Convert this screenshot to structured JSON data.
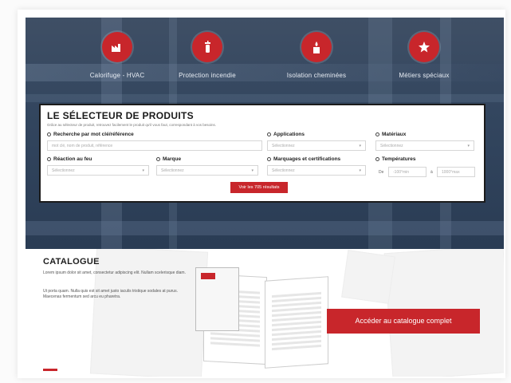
{
  "categories": [
    {
      "label": "Calorifuge - HVAC",
      "icon": "factory-icon"
    },
    {
      "label": "Protection incendie",
      "icon": "fire-extinguisher-icon"
    },
    {
      "label": "Isolation cheminées",
      "icon": "chimney-flame-icon"
    },
    {
      "label": "Métiers spéciaux",
      "icon": "star-icon"
    }
  ],
  "selector": {
    "title": "LE SÉLECTEUR DE PRODUITS",
    "subtitle": "Grâce au sélecteur de produit, retrouvez facilement le produit qu'il vous faut, correspondant à vos besoins.",
    "fields": {
      "keyword": {
        "label": "Recherche par mot clé/référence",
        "placeholder": "mot clé, nom de produit, référence"
      },
      "applications": {
        "label": "Applications",
        "placeholder": "Sélectionnez"
      },
      "materials": {
        "label": "Matériaux",
        "placeholder": "Sélectionnez"
      },
      "fire_reaction": {
        "label": "Réaction au feu",
        "placeholder": "Sélectionnez"
      },
      "brand": {
        "label": "Marque",
        "placeholder": "Sélectionnez"
      },
      "certifications": {
        "label": "Marquages et certifications",
        "placeholder": "Sélectionnez"
      },
      "temperatures": {
        "label": "Températures",
        "from_label": "De",
        "to_label": "à",
        "min_placeholder": "-100°min",
        "max_placeholder": "1000°max"
      }
    },
    "results_button": "Voir les 705 résultats"
  },
  "catalogue": {
    "title": "CATALOGUE",
    "text1": "Lorem ipsum dolor sit amet, consectetur adipiscing elit. Nullam scelerisque diam.",
    "text2": "Ut porta quam. Nulla quis est sit amet justo iaculis tristique sodales at purus. Maecenas fermentum sed arcu eu pharetra.",
    "access_button": "Accéder au catalogue complet"
  },
  "colors": {
    "accent": "#c8262b",
    "hero": "#33465f"
  }
}
